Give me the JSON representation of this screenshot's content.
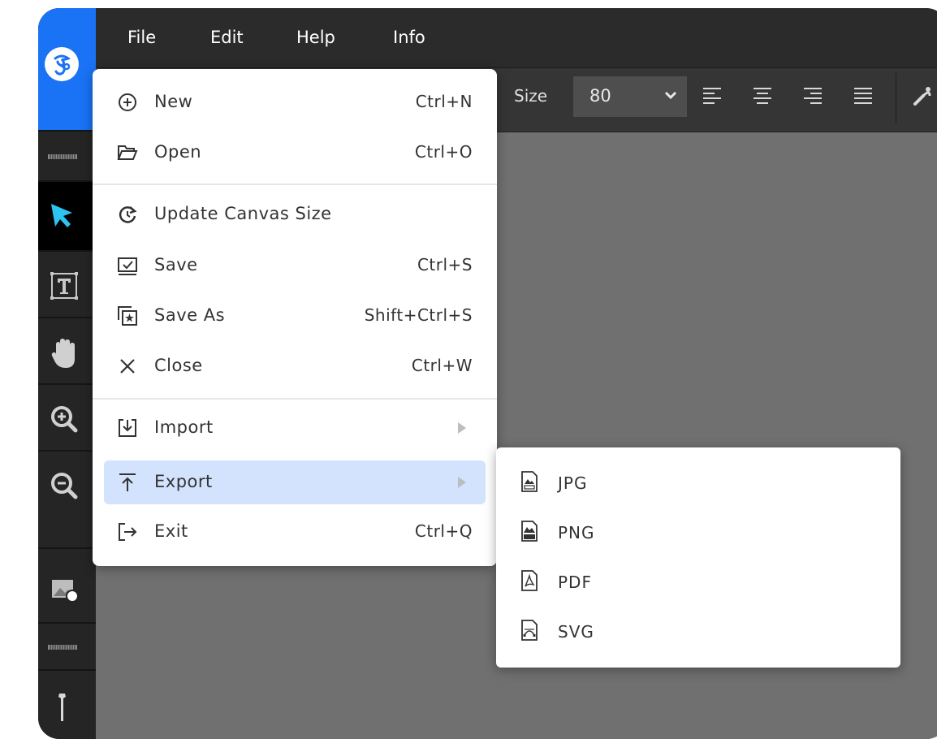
{
  "menubar": {
    "items": [
      {
        "label": "File"
      },
      {
        "label": "Edit"
      },
      {
        "label": "Help"
      },
      {
        "label": "Info"
      }
    ]
  },
  "toolbar": {
    "size_label": "Size",
    "size_value": "80",
    "align_icons": [
      "align-left-icon",
      "align-center-icon",
      "align-right-icon",
      "align-justify-icon"
    ]
  },
  "sidebar": {
    "tools": [
      "select-tool",
      "text-tool",
      "pan-tool",
      "zoom-in-tool",
      "zoom-out-tool",
      "image-tool",
      "brush-tool"
    ],
    "active_tool": "select-tool"
  },
  "file_menu": {
    "items": [
      {
        "label": "New",
        "shortcut": "Ctrl+N",
        "icon": "plus-circle-icon"
      },
      {
        "label": "Open",
        "shortcut": "Ctrl+O",
        "icon": "folder-open-icon"
      },
      {
        "label": "Update Canvas Size",
        "shortcut": "",
        "icon": "refresh-icon"
      },
      {
        "label": "Save",
        "shortcut": "Ctrl+S",
        "icon": "save-icon"
      },
      {
        "label": "Save As",
        "shortcut": "Shift+Ctrl+S",
        "icon": "save-as-icon"
      },
      {
        "label": "Close",
        "shortcut": "Ctrl+W",
        "icon": "close-icon"
      },
      {
        "label": "Import",
        "shortcut": "",
        "icon": "import-icon"
      },
      {
        "label": "Export",
        "shortcut": "",
        "icon": "export-icon"
      },
      {
        "label": "Exit",
        "shortcut": "Ctrl+Q",
        "icon": "exit-icon"
      }
    ],
    "highlighted": "Export"
  },
  "export_submenu": {
    "items": [
      {
        "label": "JPG",
        "icon": "jpg-file-icon"
      },
      {
        "label": "PNG",
        "icon": "png-file-icon"
      },
      {
        "label": "PDF",
        "icon": "pdf-file-icon"
      },
      {
        "label": "SVG",
        "icon": "svg-file-icon"
      }
    ]
  },
  "colors": {
    "accent": "#1a73f5",
    "highlight": "#d3e3fd",
    "select_tool": "#2ec4f0",
    "canvas": "#707070"
  }
}
